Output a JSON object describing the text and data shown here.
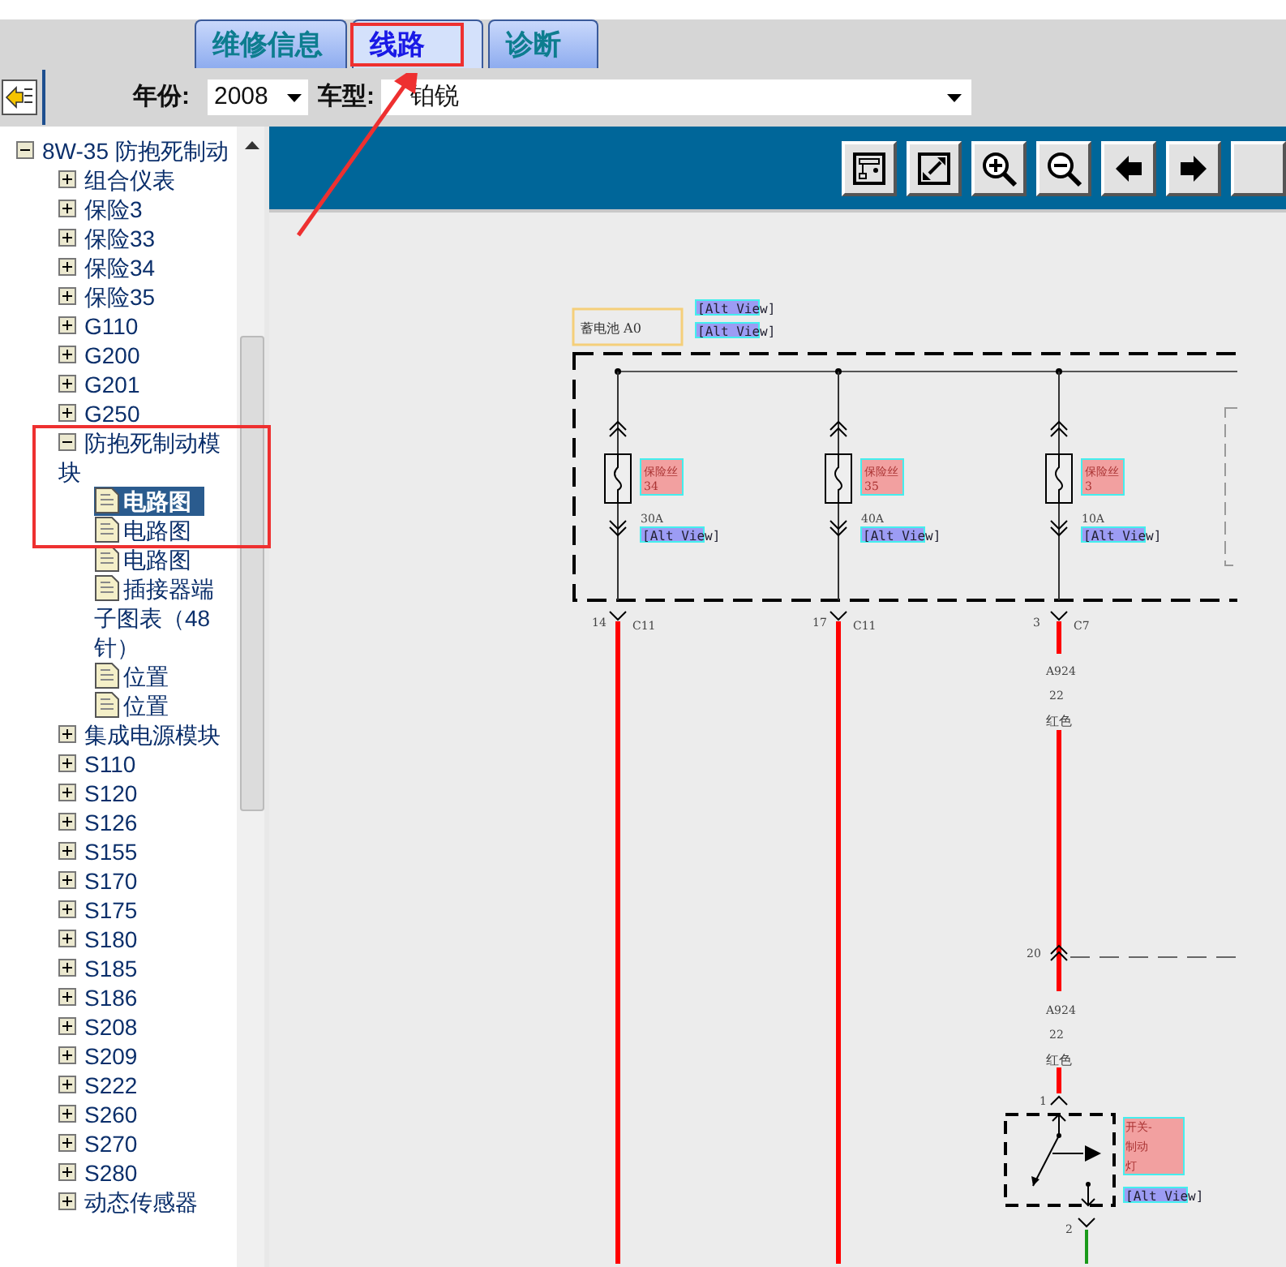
{
  "tabs": [
    {
      "label": "维修信息",
      "selected": false
    },
    {
      "label": "线路",
      "selected": true
    },
    {
      "label": "诊断",
      "selected": false
    }
  ],
  "filters": {
    "year_label": "年份:",
    "year_value": "2008",
    "model_label": "车型:",
    "model_value": "铂锐"
  },
  "tree": [
    {
      "kind": "folder",
      "label": "8W-35 防抱死制动",
      "expanded": true,
      "selected": false,
      "children": [
        {
          "kind": "folder",
          "label": "组合仪表",
          "expanded": false,
          "selected": false
        },
        {
          "kind": "folder",
          "label": "保险3",
          "expanded": false,
          "selected": false
        },
        {
          "kind": "folder",
          "label": "保险33",
          "expanded": false,
          "selected": false
        },
        {
          "kind": "folder",
          "label": "保险34",
          "expanded": false,
          "selected": false
        },
        {
          "kind": "folder",
          "label": "保险35",
          "expanded": false,
          "selected": false
        },
        {
          "kind": "folder",
          "label": "G110",
          "expanded": false,
          "selected": false
        },
        {
          "kind": "folder",
          "label": "G200",
          "expanded": false,
          "selected": false
        },
        {
          "kind": "folder",
          "label": "G201",
          "expanded": false,
          "selected": false
        },
        {
          "kind": "folder",
          "label": "G250",
          "expanded": false,
          "selected": false
        },
        {
          "kind": "folder",
          "label": "防抱死制动模块",
          "expanded": true,
          "selected": false,
          "children": [
            {
              "kind": "document",
              "label": "电路图",
              "selected": true
            },
            {
              "kind": "document",
              "label": "电路图",
              "selected": false
            },
            {
              "kind": "document",
              "label": "电路图",
              "selected": false
            },
            {
              "kind": "document",
              "label": "插接器端子图表（48针）",
              "selected": false
            },
            {
              "kind": "document",
              "label": "位置",
              "selected": false
            },
            {
              "kind": "document",
              "label": "位置",
              "selected": false
            }
          ]
        },
        {
          "kind": "folder",
          "label": "集成电源模块",
          "expanded": false,
          "selected": false
        },
        {
          "kind": "folder",
          "label": "S110",
          "expanded": false,
          "selected": false
        },
        {
          "kind": "folder",
          "label": "S120",
          "expanded": false,
          "selected": false
        },
        {
          "kind": "folder",
          "label": "S126",
          "expanded": false,
          "selected": false
        },
        {
          "kind": "folder",
          "label": "S155",
          "expanded": false,
          "selected": false
        },
        {
          "kind": "folder",
          "label": "S170",
          "expanded": false,
          "selected": false
        },
        {
          "kind": "folder",
          "label": "S175",
          "expanded": false,
          "selected": false
        },
        {
          "kind": "folder",
          "label": "S180",
          "expanded": false,
          "selected": false
        },
        {
          "kind": "folder",
          "label": "S185",
          "expanded": false,
          "selected": false
        },
        {
          "kind": "folder",
          "label": "S186",
          "expanded": false,
          "selected": false
        },
        {
          "kind": "folder",
          "label": "S208",
          "expanded": false,
          "selected": false
        },
        {
          "kind": "folder",
          "label": "S209",
          "expanded": false,
          "selected": false
        },
        {
          "kind": "folder",
          "label": "S222",
          "expanded": false,
          "selected": false
        },
        {
          "kind": "folder",
          "label": "S260",
          "expanded": false,
          "selected": false
        },
        {
          "kind": "folder",
          "label": "S270",
          "expanded": false,
          "selected": false
        },
        {
          "kind": "folder",
          "label": "S280",
          "expanded": false,
          "selected": false
        },
        {
          "kind": "folder",
          "label": "动态传感器",
          "expanded": false,
          "selected": false
        }
      ]
    }
  ],
  "diagram": {
    "source": {
      "label": "蓄电池 A0",
      "alt_views": [
        "[Alt View]",
        "[Alt View]"
      ]
    },
    "fuses": [
      {
        "name": "保险丝",
        "number": "34",
        "rating": "30A",
        "alt_view": "[Alt View]",
        "pin": "14",
        "connector": "C11"
      },
      {
        "name": "保险丝",
        "number": "35",
        "rating": "40A",
        "alt_view": "[Alt View]",
        "pin": "17",
        "connector": "C11"
      },
      {
        "name": "保险丝",
        "number": "3",
        "rating": "10A",
        "alt_view": "[Alt View]",
        "pin": "3",
        "connector": "C7"
      }
    ],
    "wire_labels": [
      {
        "code": "A924",
        "gauge": "22",
        "color_name": "红色"
      },
      {
        "code": "A924",
        "gauge": "22",
        "color_name": "红色"
      }
    ],
    "splice_pin": "20",
    "switch": {
      "label_lines": [
        "开关-",
        "制动",
        "灯"
      ],
      "alt_view": "[Alt View]",
      "pin_in": "1",
      "pin_out": "2"
    }
  }
}
